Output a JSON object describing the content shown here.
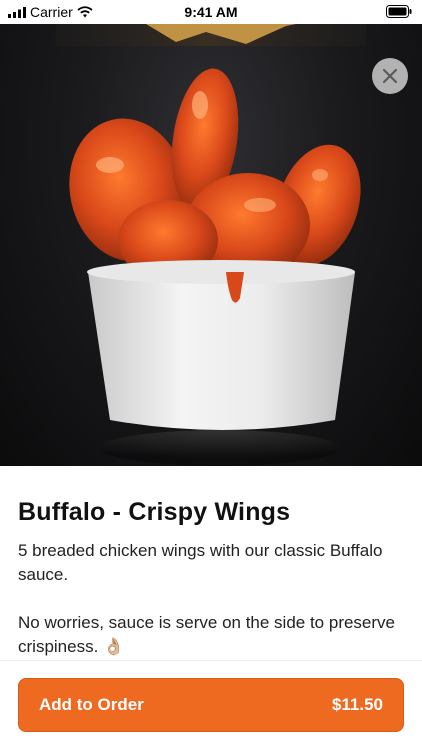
{
  "status_bar": {
    "carrier": "Carrier",
    "time": "9:41 AM"
  },
  "product": {
    "title": "Buffalo - Crispy Wings",
    "description_line1": "5 breaded chicken wings with our classic Buffalo sauce.",
    "description_line2": "No worries, sauce is serve on the side to preserve crispiness. 👌🏼"
  },
  "actions": {
    "add_label": "Add to Order",
    "price": "$11.50"
  },
  "colors": {
    "accent": "#ee6a20",
    "hero_bg": "#141416",
    "sauce": "#e1541a"
  },
  "icons": {
    "close": "close-icon",
    "signal": "signal-icon",
    "wifi": "wifi-icon",
    "battery": "battery-icon"
  }
}
